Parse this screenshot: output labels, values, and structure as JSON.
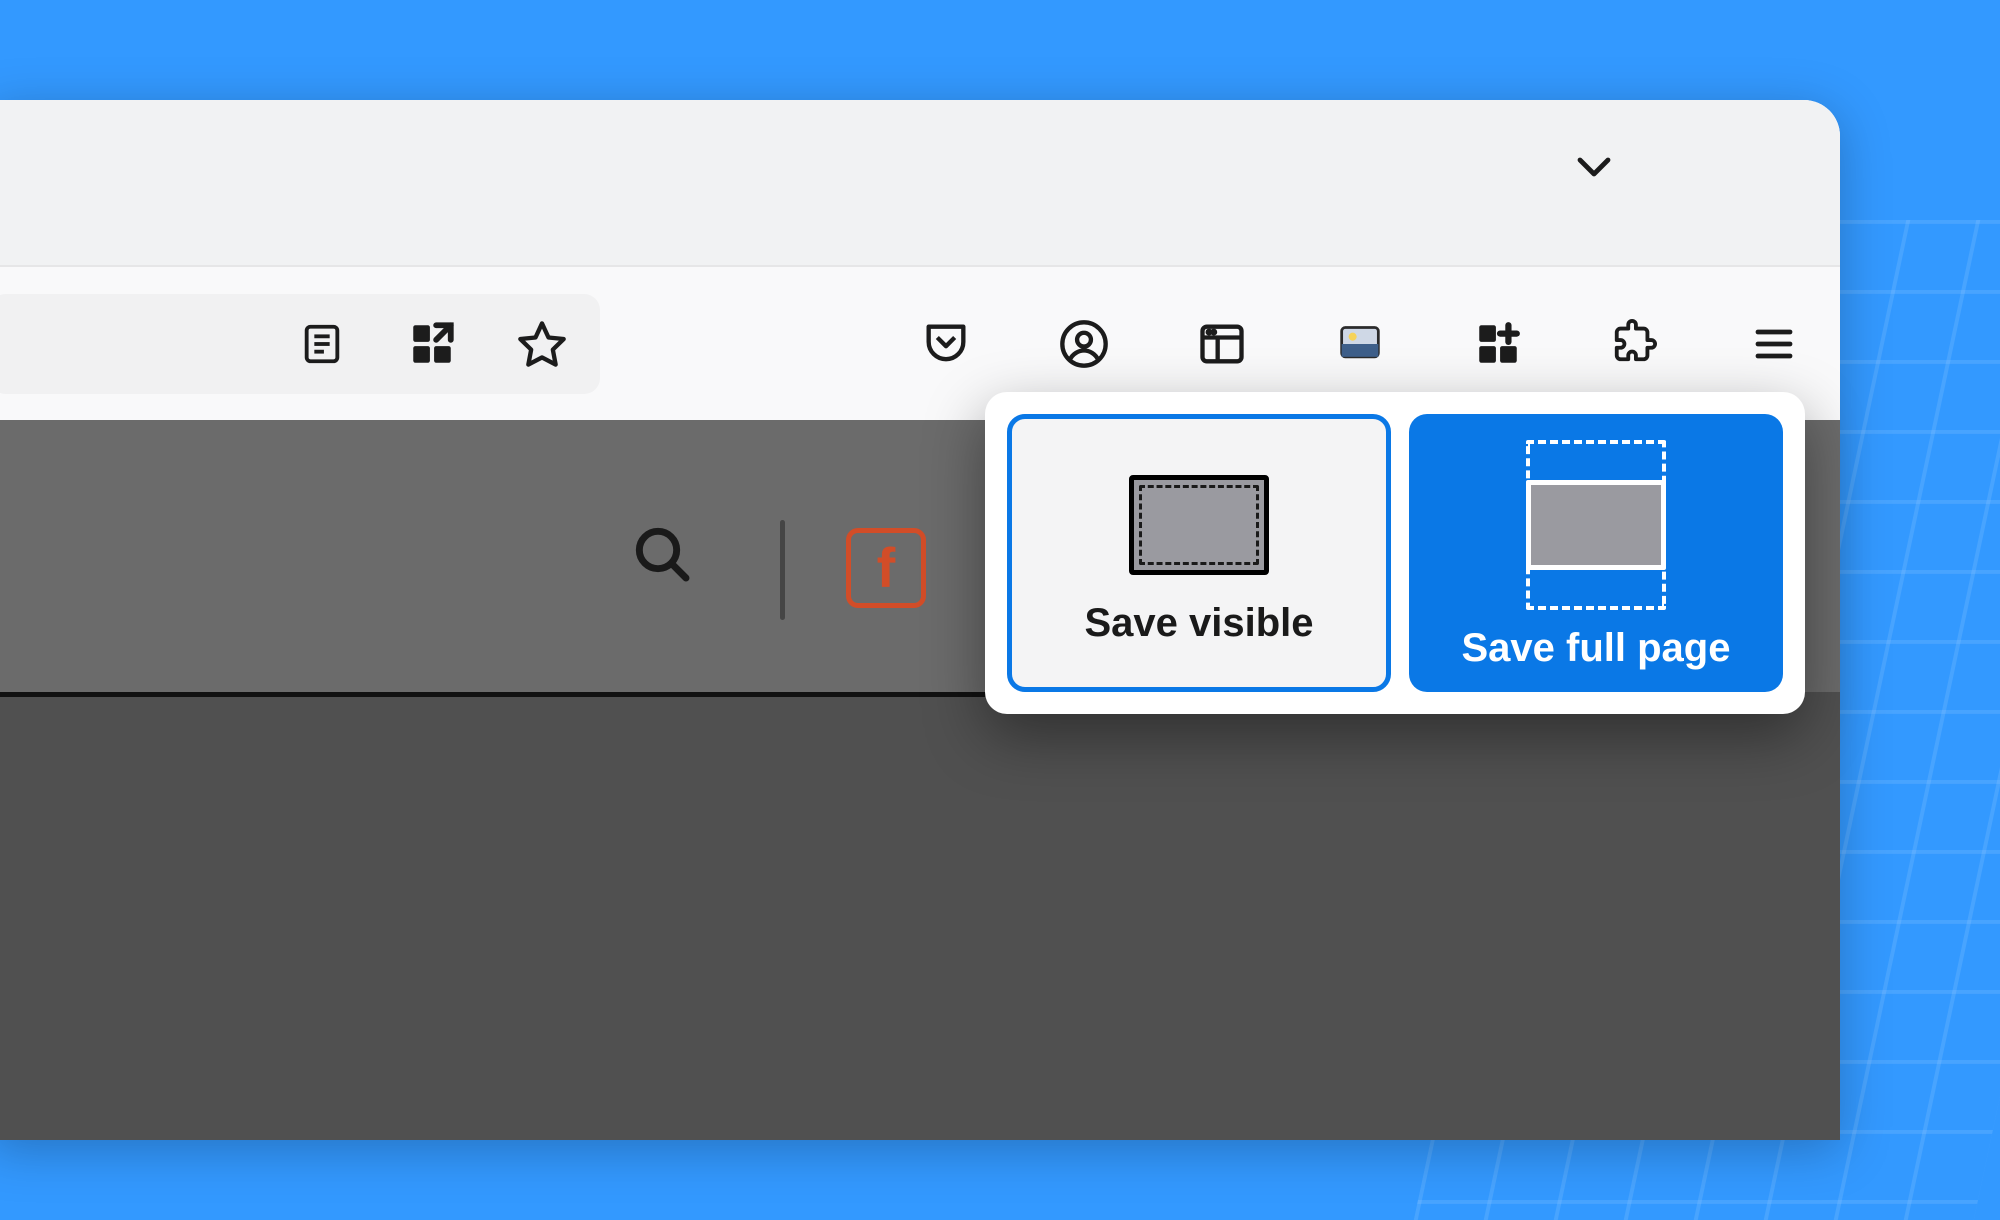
{
  "colors": {
    "accent": "#0a78e6",
    "page_bg": "#3399ff",
    "fb_color": "#d24d28"
  },
  "toolbar": {
    "icons": {
      "reader": "reader-view-icon",
      "apps": "apps-icon",
      "star": "bookmark-star-icon",
      "pocket": "pocket-icon",
      "account": "account-icon",
      "sidebar": "sidebar-panel-icon",
      "picture": "picture-icon",
      "add_apps": "add-to-apps-icon",
      "extensions": "extensions-puzzle-icon",
      "menu": "hamburger-menu-icon",
      "tab_dropdown": "chevron-down-icon"
    }
  },
  "page": {
    "icons": {
      "search": "search-icon",
      "facebook": "facebook-icon"
    },
    "facebook_glyph": "f"
  },
  "screenshot_popup": {
    "save_visible": "Save visible",
    "save_full": "Save full page"
  }
}
